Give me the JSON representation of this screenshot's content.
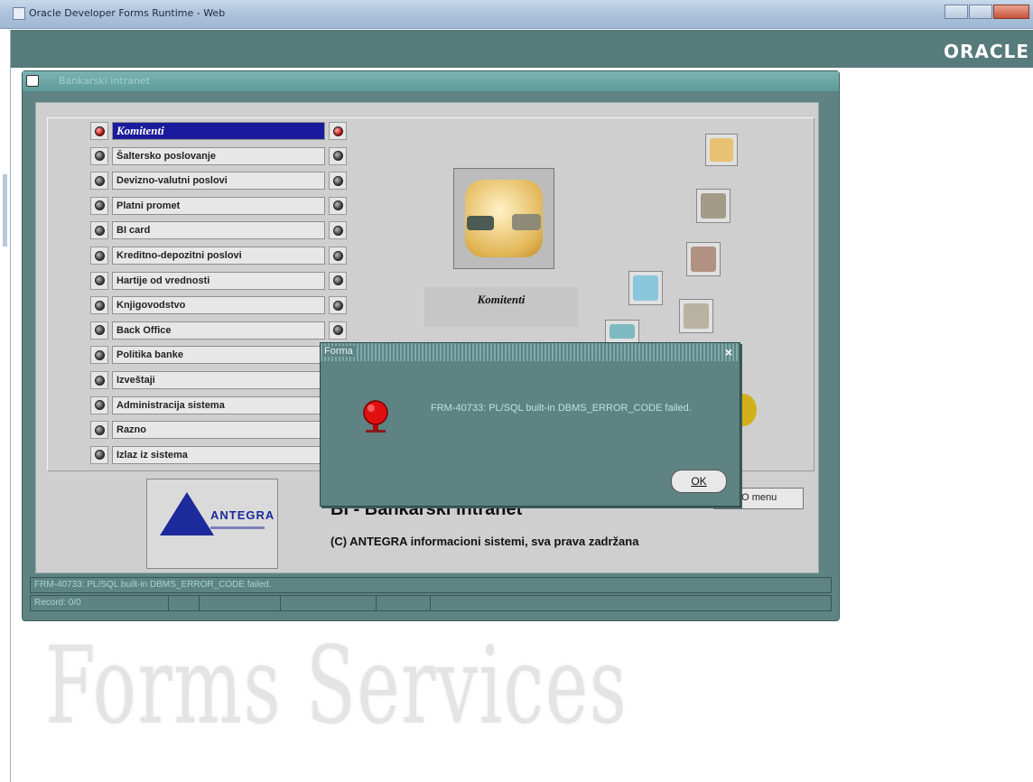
{
  "window": {
    "title": "Oracle Developer Forms Runtime - Web",
    "oracle_logo": "ORACLE"
  },
  "watermark": "Forms Services",
  "forms_window": {
    "title": "Bankarski intranet"
  },
  "menu": {
    "items": [
      {
        "label": "Komitenti",
        "selected": true
      },
      {
        "label": "Šaltersko poslovanje"
      },
      {
        "label": "Devizno-valutni poslovi"
      },
      {
        "label": "Platni promet"
      },
      {
        "label": "BI card"
      },
      {
        "label": "Kreditno-depozitni poslovi"
      },
      {
        "label": "Hartije od vrednosti"
      },
      {
        "label": "Knjigovodstvo"
      },
      {
        "label": "Back Office"
      },
      {
        "label": "Politika banke"
      },
      {
        "label": "Izveštaji"
      },
      {
        "label": "Administracija sistema"
      },
      {
        "label": "Razno"
      },
      {
        "label": "Izlaz iz sistema"
      }
    ]
  },
  "picture": {
    "caption": "Komitenti"
  },
  "branding": {
    "logo_text": "ANTEGRA",
    "app_name": "BI - Bankarski intranet",
    "copyright": "(C) ANTEGRA informacioni sistemi, sva prava zadržana"
  },
  "menu_button": {
    "label": "pO menu"
  },
  "status": {
    "message": "FRM-40733: PL/SQL built-in DBMS_ERROR_CODE failed.",
    "record": "Record: 0/0"
  },
  "dialog": {
    "title": "Forma",
    "message": "FRM-40733: PL/SQL built-in DBMS_ERROR_CODE failed.",
    "ok_label": "OK",
    "close_glyph": "×"
  },
  "colors": {
    "forms_bg": "#5f8383",
    "selected_item": "#1a1a9c",
    "stop_red": "#e01010"
  }
}
